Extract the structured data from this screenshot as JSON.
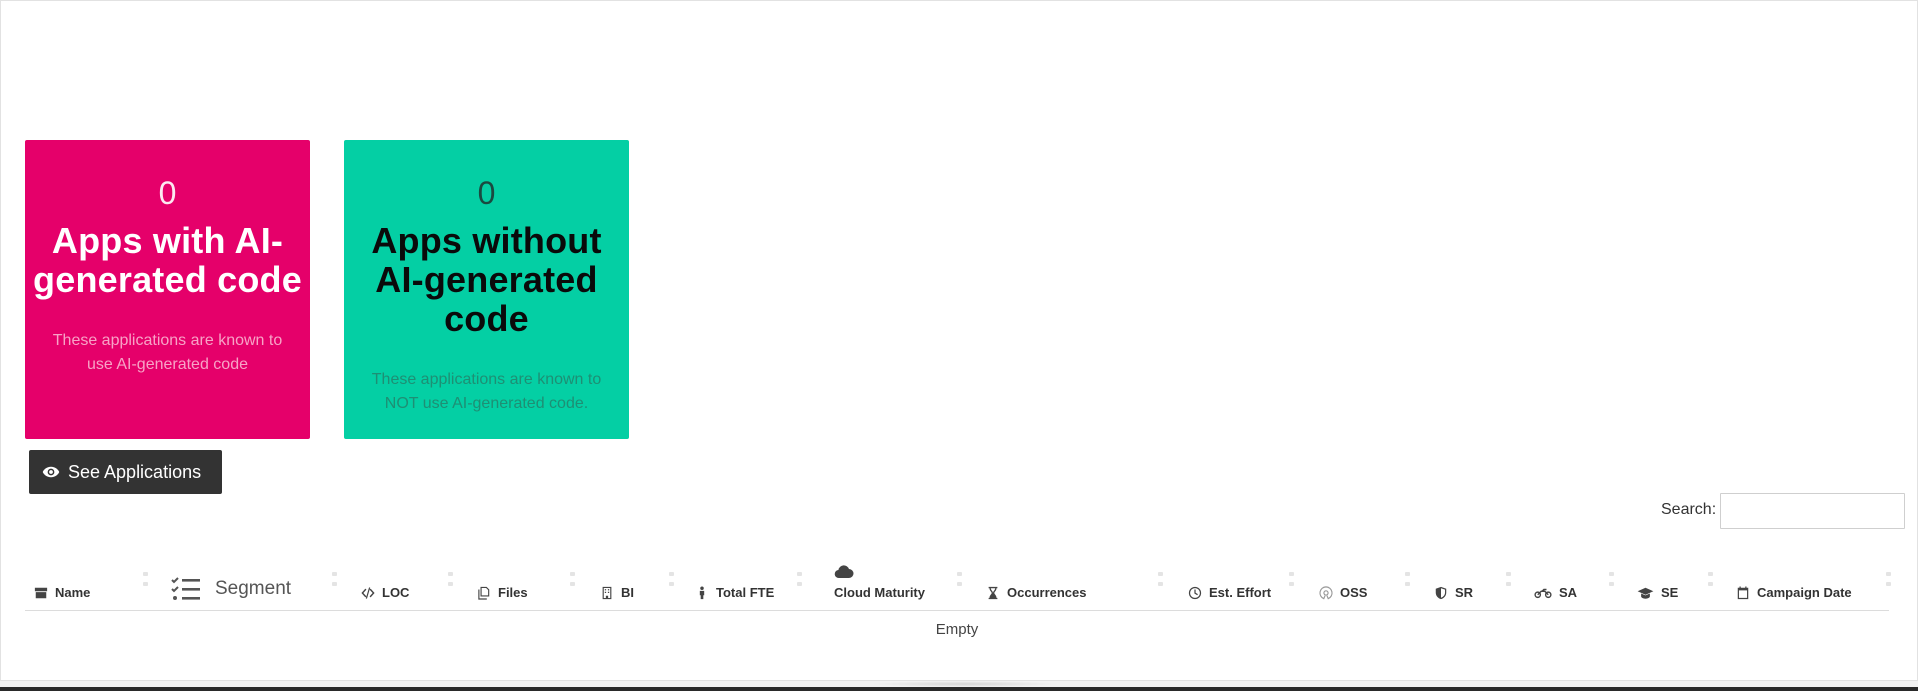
{
  "cards": [
    {
      "count": "0",
      "title": "Apps with AI-generated code",
      "description": "These applications are known to use AI-generated code",
      "color": "#e5006a"
    },
    {
      "count": "0",
      "title": "Apps without AI-generated code",
      "description": "These applications are known to NOT use AI-generated code.",
      "color": "#04cfa4"
    }
  ],
  "see_button": {
    "label": "See Applications",
    "icon": "eye-icon"
  },
  "search": {
    "label": "Search:",
    "value": ""
  },
  "table": {
    "columns": [
      {
        "label": "Name",
        "icon": "archive-icon"
      },
      {
        "label": "Segment",
        "icon": "checklist-icon"
      },
      {
        "label": "LOC",
        "icon": "code-icon"
      },
      {
        "label": "Files",
        "icon": "files-icon"
      },
      {
        "label": "BI",
        "icon": "building-icon"
      },
      {
        "label": "Total FTE",
        "icon": "person-icon"
      },
      {
        "label": "Cloud Maturity",
        "icon": "cloud-icon"
      },
      {
        "label": "Occurrences",
        "icon": "hourglass-icon"
      },
      {
        "label": "Est. Effort",
        "icon": "clock-icon"
      },
      {
        "label": "OSS",
        "icon": "oss-icon"
      },
      {
        "label": "SR",
        "icon": "shield-icon"
      },
      {
        "label": "SA",
        "icon": "motorcycle-icon"
      },
      {
        "label": "SE",
        "icon": "graduation-cap-icon"
      },
      {
        "label": "Campaign Date",
        "icon": "calendar-icon"
      }
    ],
    "empty_text": "Empty"
  }
}
